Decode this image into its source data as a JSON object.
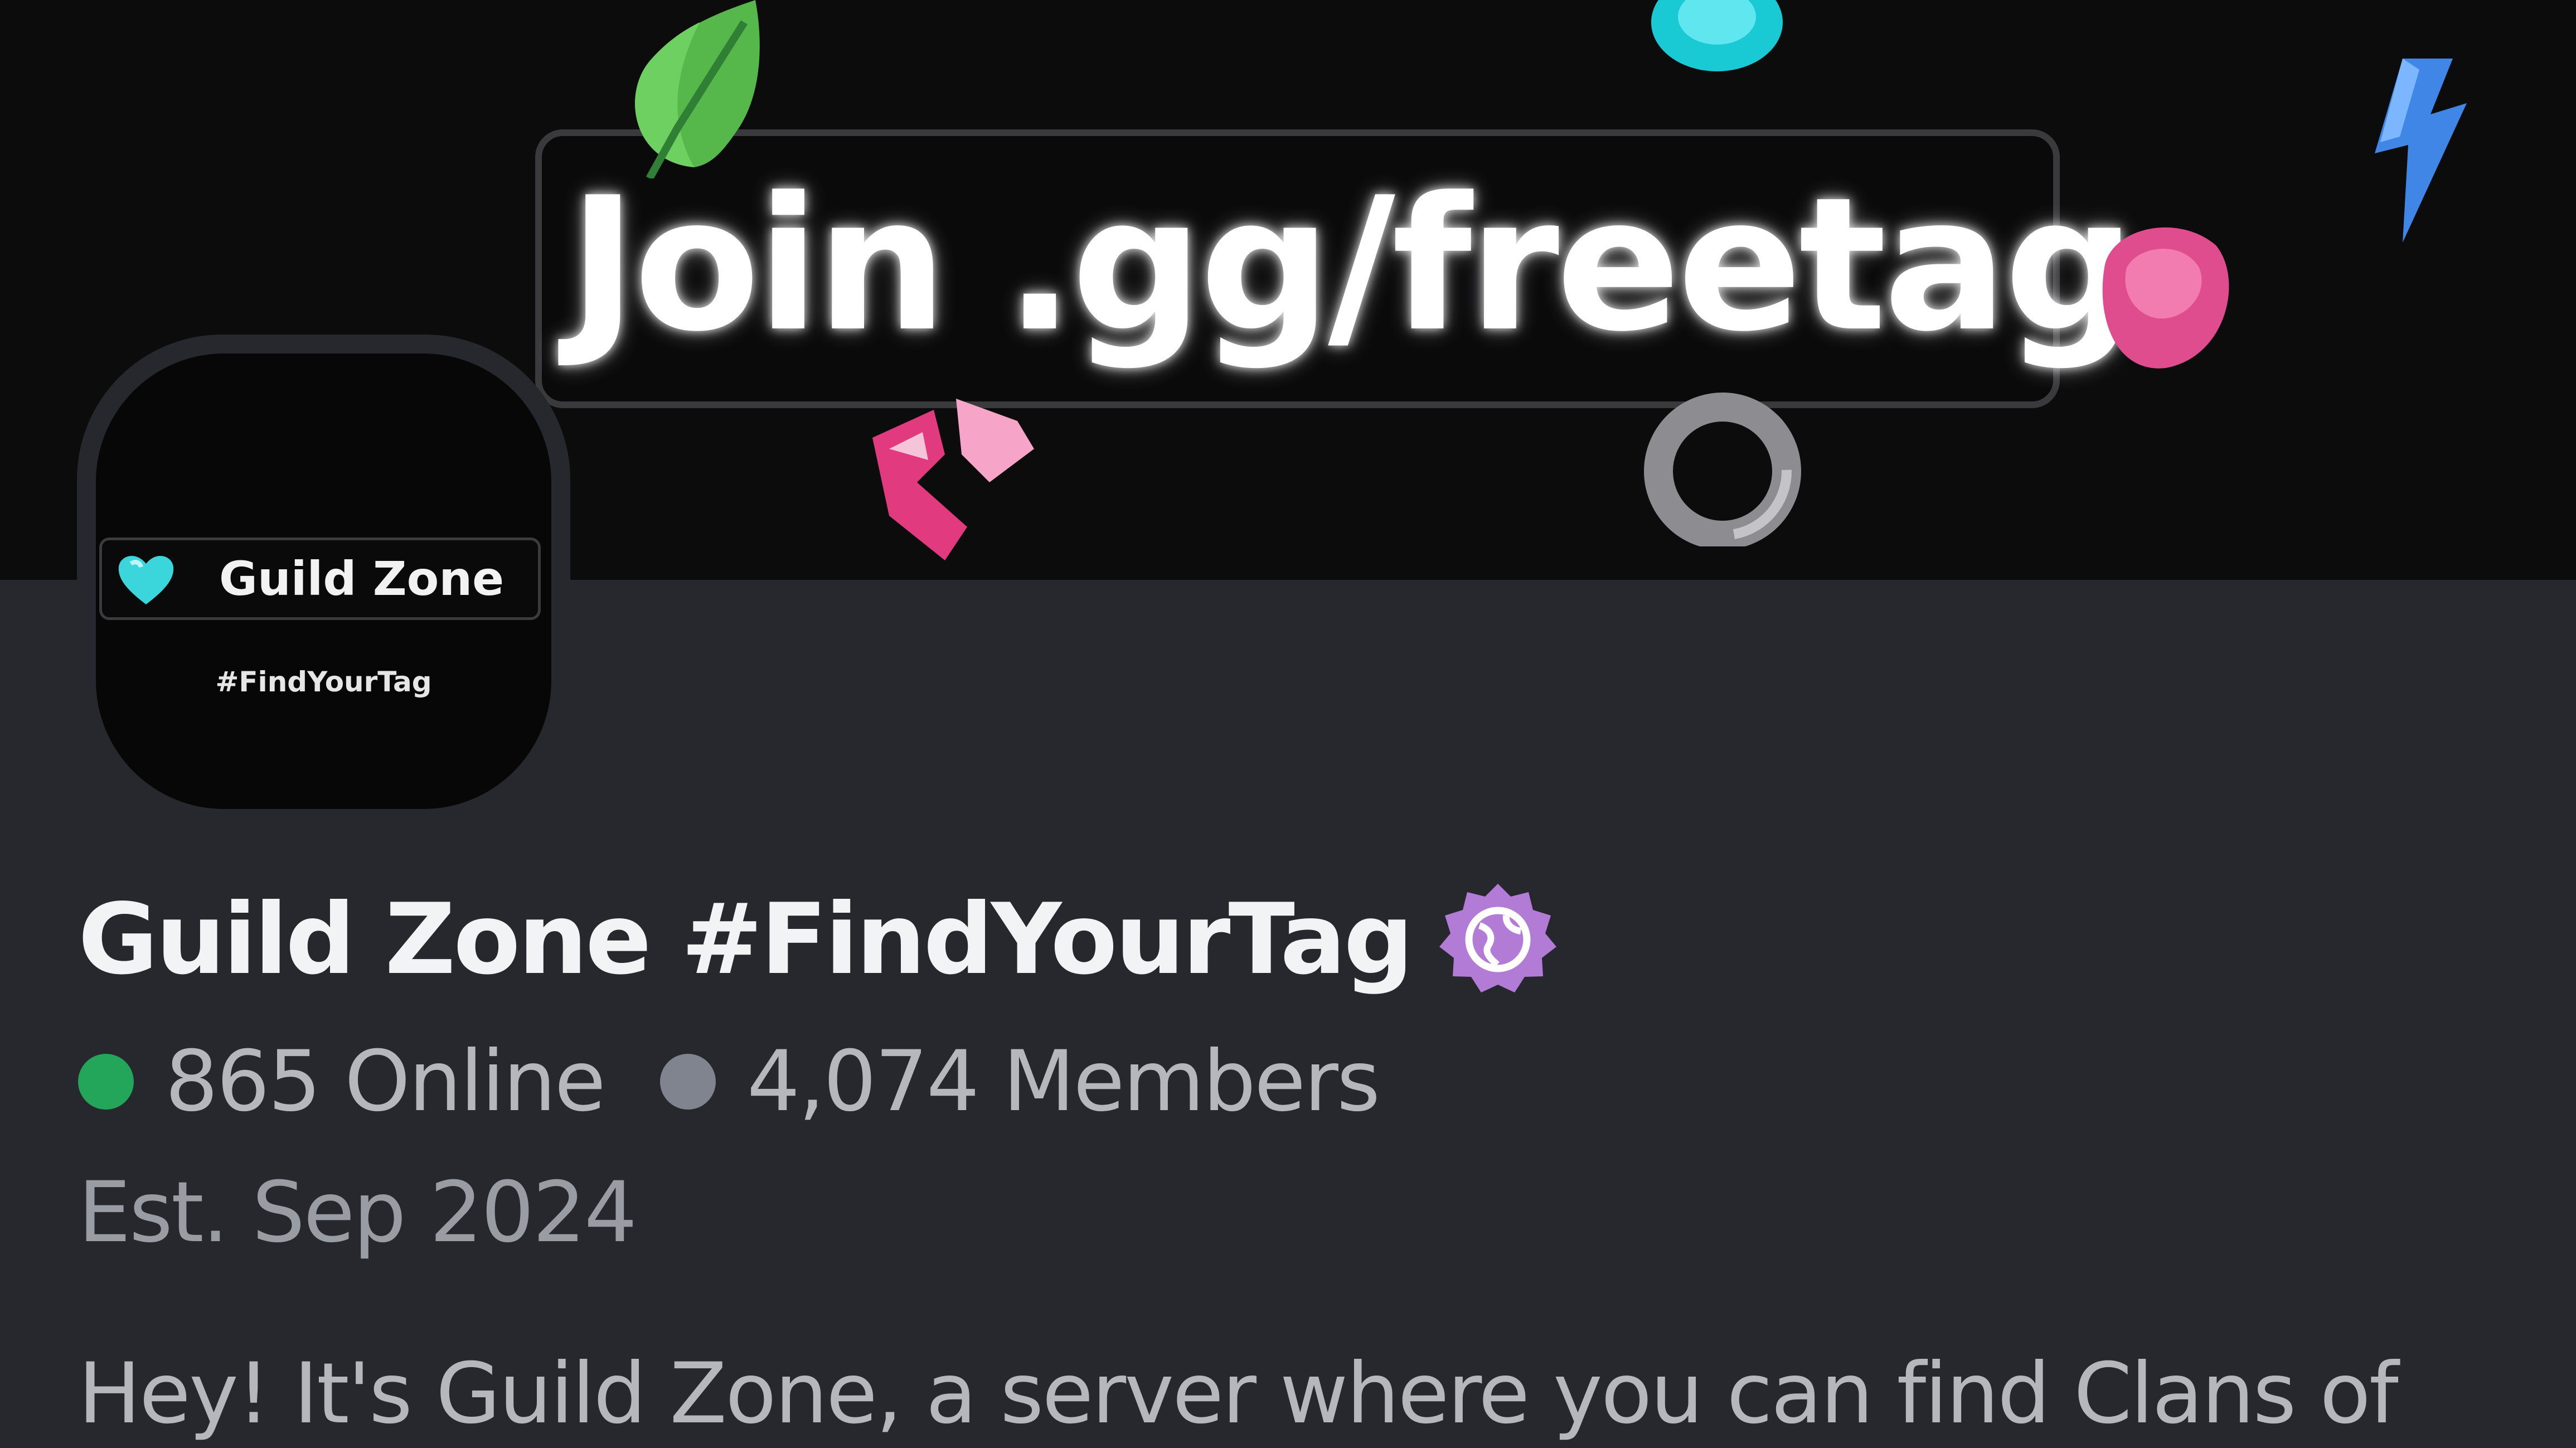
{
  "banner": {
    "text": "Join .gg/freetag",
    "stickers": [
      "leaf-icon",
      "cyan-gem-icon",
      "lightning-bolt-icon",
      "pink-gem-icon",
      "broken-heart-icon",
      "gray-ring-icon"
    ]
  },
  "server_icon": {
    "tag_name": "Guild Zone",
    "tag_icon": "cyan-heart-icon",
    "subtitle": "#FindYourTag"
  },
  "server": {
    "name": "Guild Zone #FindYourTag",
    "badge_icon": "discoverable-globe-badge-icon",
    "online": "865 Online",
    "members": "4,074 Members",
    "established": "Est. Sep 2024",
    "description": "Hey! It's Guild Zone, a server where you can find Clans of"
  },
  "colors": {
    "background": "#27282d",
    "banner_background": "#0c0c0d",
    "online_dot": "#23a55a",
    "members_dot": "#80848e",
    "badge": "#b27bd6",
    "heart": "#3ad6dc"
  }
}
